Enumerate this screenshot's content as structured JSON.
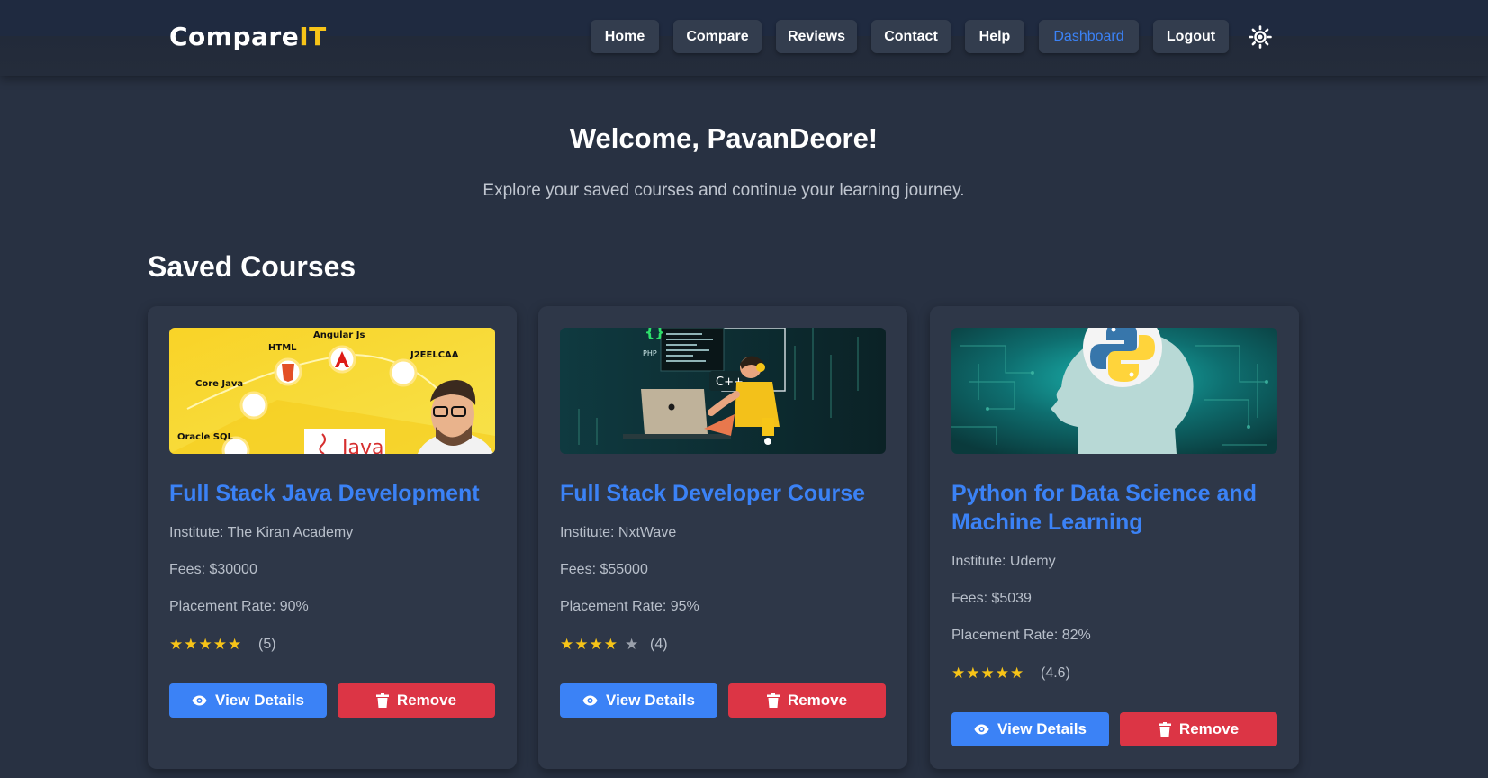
{
  "brand": {
    "name_main": "Compare",
    "name_accent": "IT"
  },
  "nav": {
    "home": "Home",
    "compare": "Compare",
    "reviews": "Reviews",
    "contact": "Contact",
    "help": "Help",
    "dashboard": "Dashboard",
    "logout": "Logout",
    "theme_icon": "sun-icon"
  },
  "hero": {
    "welcome": "Welcome, PavanDeore!",
    "subtitle": "Explore your saved courses and continue your learning journey."
  },
  "saved": {
    "heading": "Saved Courses",
    "courses": [
      {
        "title": "Full Stack Java Development",
        "institute": "Institute: The Kiran Academy",
        "fees": "Fees: $30000",
        "placement": "Placement Rate: 90%",
        "rating": 5,
        "rating_label": "(5)",
        "stars_full": "★★★★★",
        "stars_empty": "",
        "view_label": "View Details",
        "remove_label": "Remove",
        "image_labels": {
          "angular": "Angular Js",
          "html": "HTML",
          "j2ee": "J2EELCAA",
          "core_java": "Core Java",
          "oracle": "Oracle SQL",
          "java_logo": "Java"
        }
      },
      {
        "title": "Full Stack Developer Course",
        "institute": "Institute: NxtWave",
        "fees": "Fees: $55000",
        "placement": "Placement Rate: 95%",
        "rating": 4,
        "rating_label": "(4)",
        "stars_full": "★★★★",
        "stars_empty": "★",
        "view_label": "View Details",
        "remove_label": "Remove",
        "image_labels": {
          "php": "PHP",
          "cpp": "C++"
        }
      },
      {
        "title": "Python for Data Science and Machine Learning",
        "institute": "Institute: Udemy",
        "fees": "Fees: $5039",
        "placement": "Placement Rate: 82%",
        "rating": 4.6,
        "rating_label": "(4.6)",
        "stars_full": "★★★★★",
        "stars_empty": "",
        "view_label": "View Details",
        "remove_label": "Remove"
      }
    ]
  },
  "colors": {
    "background": "#283142",
    "card": "#2e3748",
    "accent_blue": "#3b82f6",
    "danger_red": "#dc3545",
    "star_yellow": "#f7c418",
    "brand_yellow": "#f7c418"
  }
}
